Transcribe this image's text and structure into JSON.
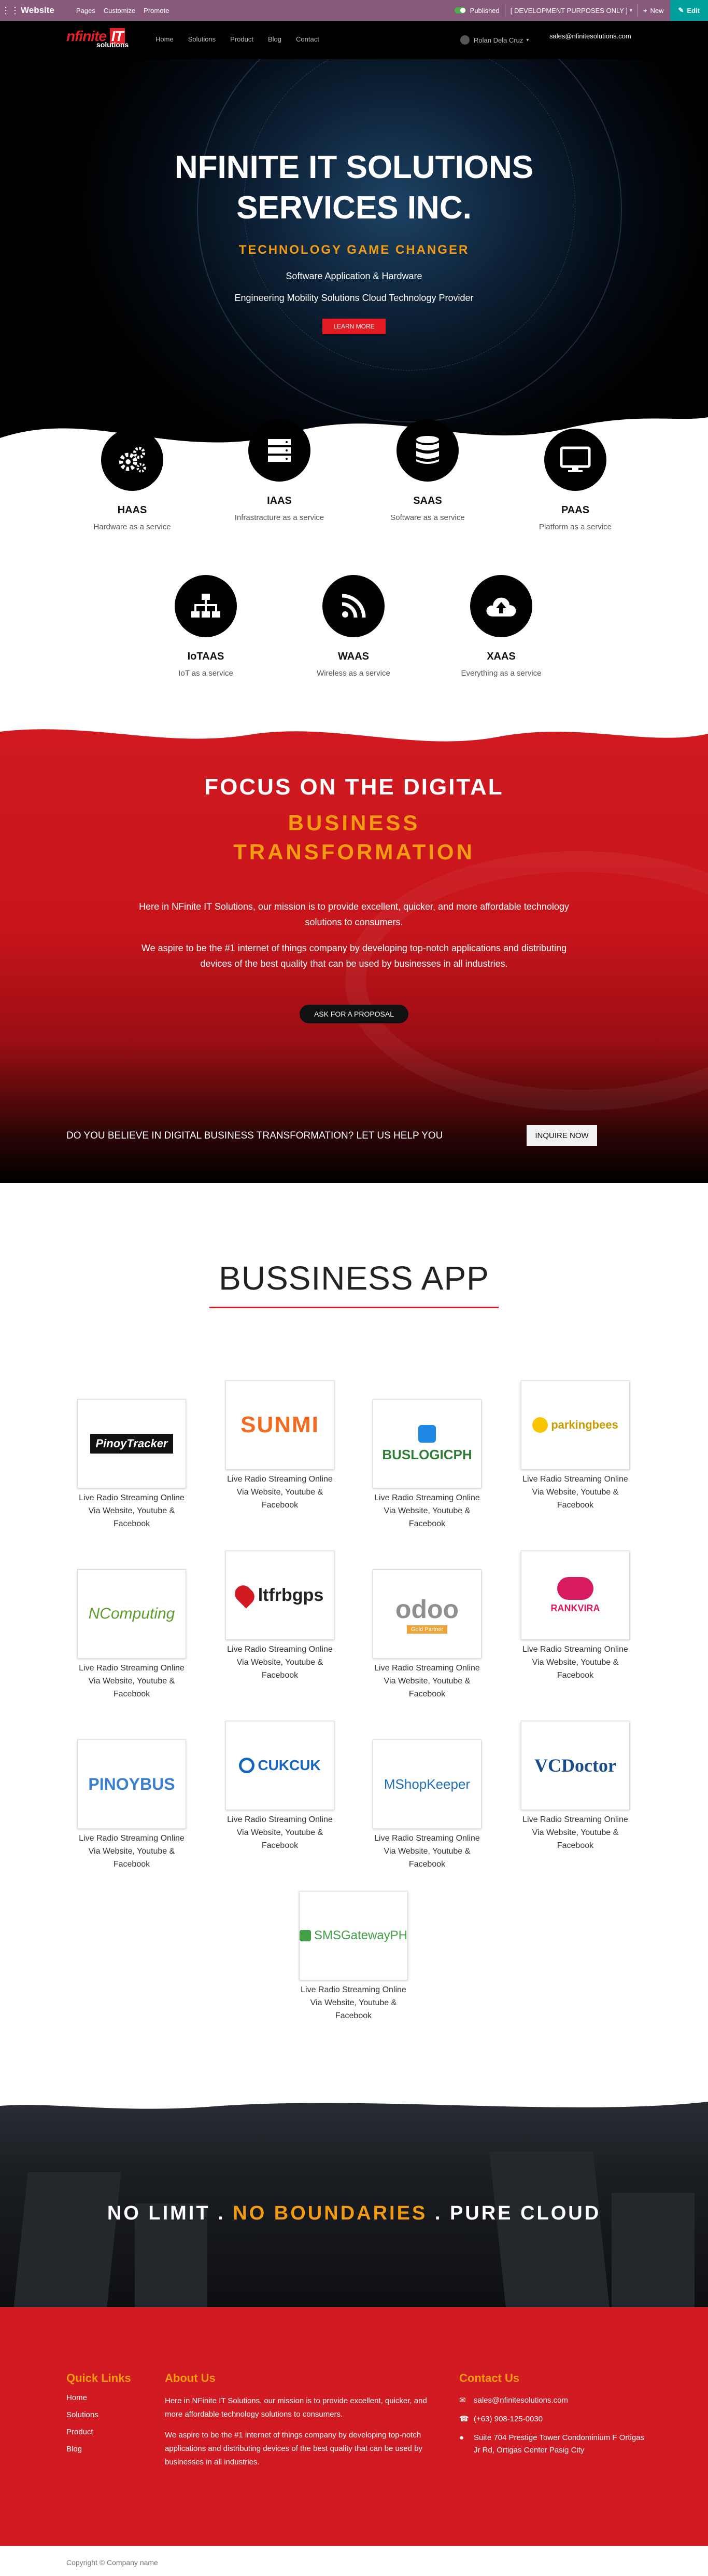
{
  "adminbar": {
    "brand": "Website",
    "menus": [
      "Pages",
      "Customize",
      "Promote"
    ],
    "published": "Published",
    "database": "[ DEVELOPMENT PURPOSES ONLY ]",
    "new": "New",
    "edit": "Edit",
    "color": "#875a7b"
  },
  "nav": {
    "logo_main": "nfinite",
    "logo_it": "IT",
    "logo_sub": "solutions",
    "links": [
      "Home",
      "Solutions",
      "Product",
      "Blog",
      "Contact"
    ],
    "user": "Rolan Dela Cruz",
    "email": "sales@nfinitesolutions.com"
  },
  "hero": {
    "title_line1": "NFINITE IT SOLUTIONS",
    "title_line2": "SERVICES INC.",
    "tagline": "TECHNOLOGY GAME CHANGER",
    "sub1": "Software Application & Hardware",
    "sub2": "Engineering Mobility Solutions Cloud Technology Provider",
    "button": "LEARN MORE"
  },
  "services": [
    {
      "name": "HAAS",
      "desc": "Hardware as a service",
      "icon": "gears-icon"
    },
    {
      "name": "IAAS",
      "desc": "Infrastracture as a service",
      "icon": "server-icon"
    },
    {
      "name": "SAAS",
      "desc": "Software as a service",
      "icon": "database-icon"
    },
    {
      "name": "PAAS",
      "desc": "Platform as a service",
      "icon": "monitor-icon"
    },
    {
      "name": "IoTAAS",
      "desc": "IoT as a service",
      "icon": "network-icon"
    },
    {
      "name": "WAAS",
      "desc": "Wireless as a service",
      "icon": "wifi-icon"
    },
    {
      "name": "XAAS",
      "desc": "Everything as a service",
      "icon": "cloud-upload-icon"
    }
  ],
  "focus": {
    "title": "FOCUS ON THE DIGITAL",
    "highlight1": "BUSINESS",
    "highlight2": "TRANSFORMATION",
    "p1": "Here in NFinite IT Solutions, our mission is to provide excellent, quicker, and more affordable technology solutions to consumers.",
    "p2": "We aspire to be the #1 internet of things company by developing top-notch applications and distributing devices of the best quality that can be used by businesses in all industries.",
    "button": "ASK FOR A PROPOSAL",
    "cta": "DO YOU BELIEVE IN DIGITAL BUSINESS TRANSFORMATION? LET US HELP YOU",
    "cta_button": "INQUIRE NOW"
  },
  "business": {
    "title": "BUSSINESS APP",
    "caption": "Live Radio Streaming Online Via Website, Youtube & Facebook",
    "apps": [
      {
        "logo": "PinoyTracker"
      },
      {
        "logo": "SUNMI"
      },
      {
        "logo": "BUSLOGICPH"
      },
      {
        "logo": "parkingbees"
      },
      {
        "logo": "NComputing"
      },
      {
        "logo": "ltfrbgps"
      },
      {
        "logo": "odoo",
        "badge": "Gold Partner"
      },
      {
        "logo": "RANKVIRA"
      },
      {
        "logo": "PINOYBUS"
      },
      {
        "logo": "CUKCUK"
      },
      {
        "logo": "MShopKeeper"
      },
      {
        "logo": "VCDoctor"
      },
      {
        "logo": "SMSGatewayPH"
      }
    ]
  },
  "cloud": {
    "part1": "NO LIMIT . ",
    "part2": "NO BOUNDARIES",
    "part3": " . PURE CLOUD"
  },
  "footer": {
    "quick_title": "Quick Links",
    "quick_links": [
      "Home",
      "Solutions",
      "Product",
      "Blog"
    ],
    "about_title": "About Us",
    "about_p1": "Here in NFinite IT Solutions, our mission is to provide excellent, quicker, and more affordable technology solutions to consumers.",
    "about_p2": "We aspire to be the #1 internet of things company by developing top-notch applications and distributing devices of the best quality that can be used by businesses in all industries.",
    "contact_title": "Contact Us",
    "email": "sales@nfinitesolutions.com",
    "phone": "(+63) 908-125-0030",
    "address": "Suite 704 Prestige Tower Condominium F Ortigas Jr Rd, Ortigas Center Pasig City",
    "copyright": "Copyright © Company name"
  },
  "colors": {
    "accent_red": "#d11a21",
    "accent_orange": "#f39c12",
    "odoo_purple": "#875a7b",
    "edit_teal": "#00a09d"
  }
}
